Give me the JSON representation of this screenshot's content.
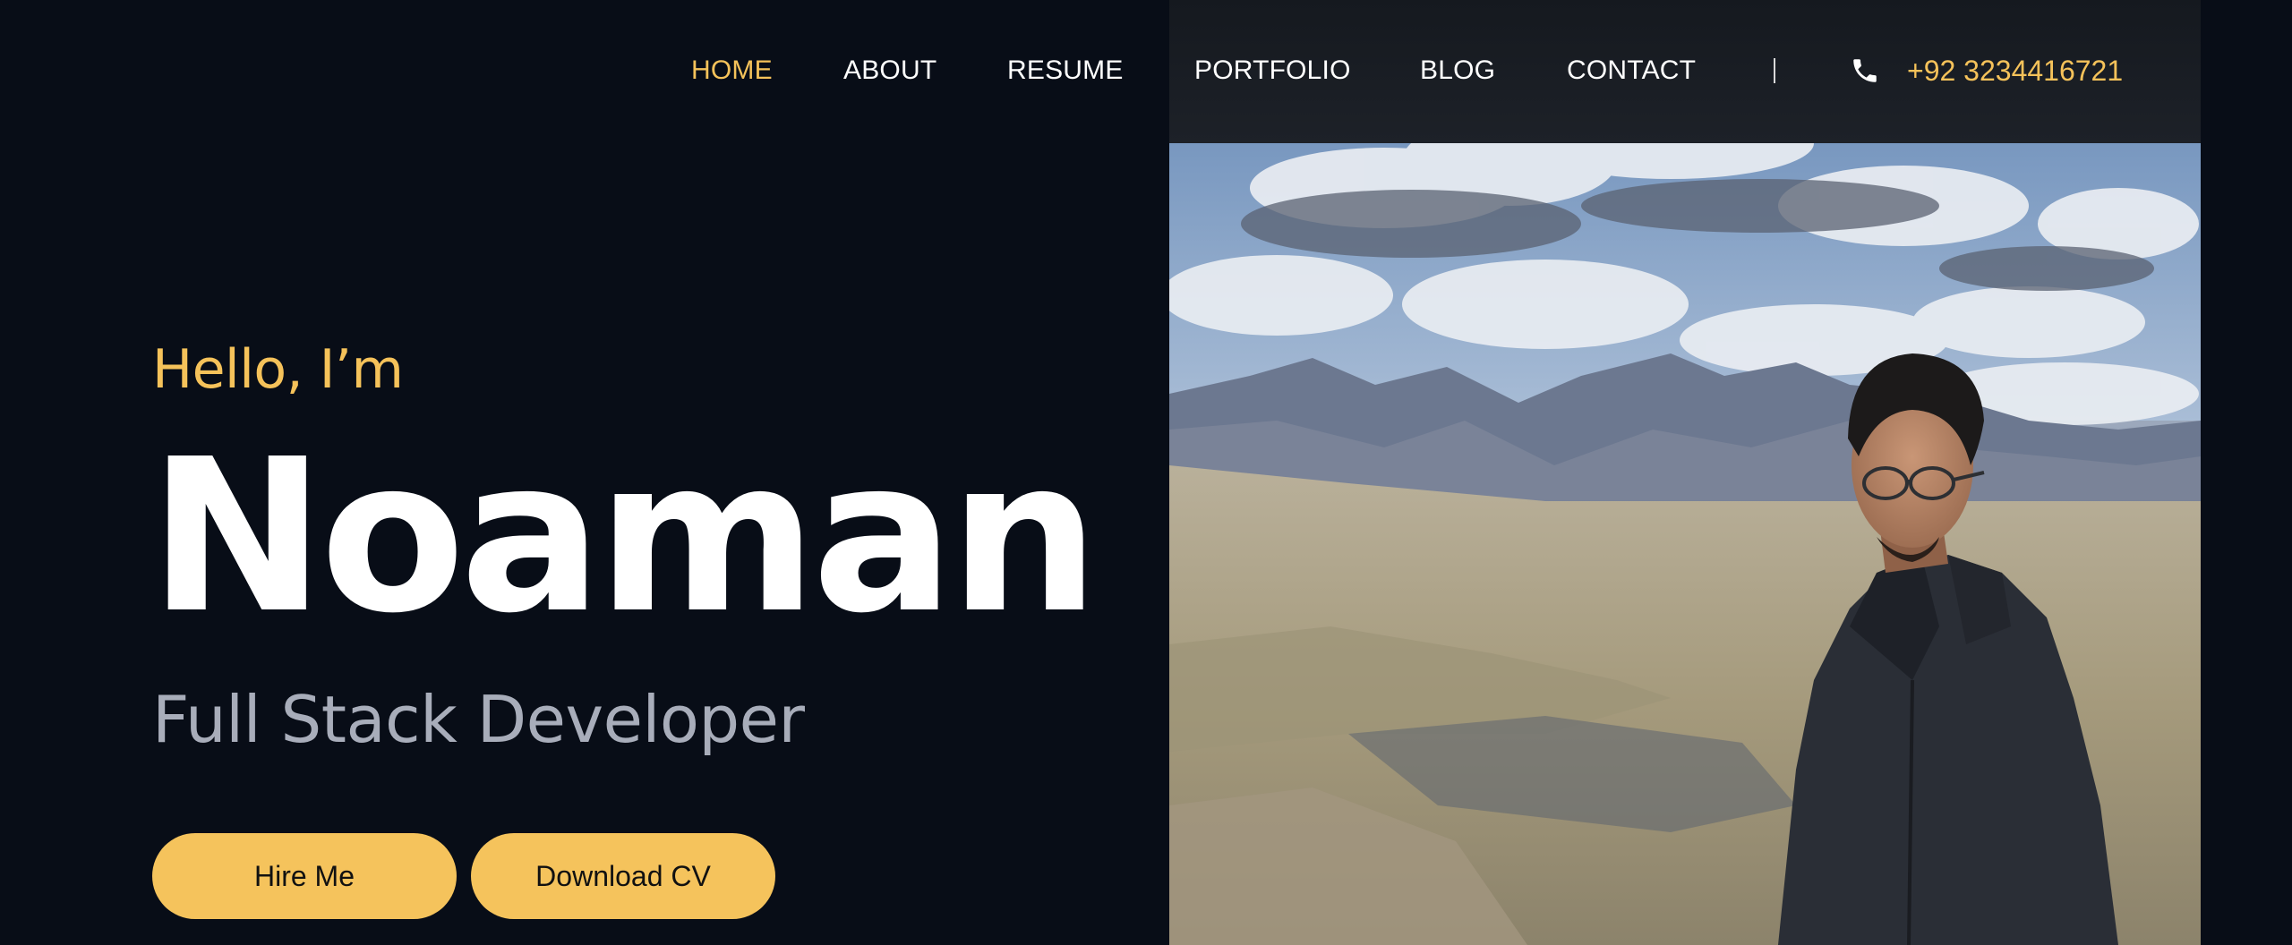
{
  "nav": {
    "items": [
      {
        "label": "HOME",
        "active": true
      },
      {
        "label": "ABOUT",
        "active": false
      },
      {
        "label": "RESUME",
        "active": false
      },
      {
        "label": "PORTFOLIO",
        "active": false
      },
      {
        "label": "BLOG",
        "active": false
      },
      {
        "label": "CONTACT",
        "active": false
      }
    ],
    "separator": "|",
    "phone_icon": "phone-icon",
    "phone_number": "+92 3234416721"
  },
  "hero": {
    "greeting": "Hello, I’m",
    "name": "Noaman",
    "role": "Full Stack Developer",
    "buttons": {
      "hire_label": "Hire Me",
      "cv_label": "Download CV"
    }
  },
  "colors": {
    "background": "#080d17",
    "accent": "#f5c25a",
    "nav_text": "#ffffff",
    "subtitle": "#a8adba",
    "button_text": "#111111"
  }
}
